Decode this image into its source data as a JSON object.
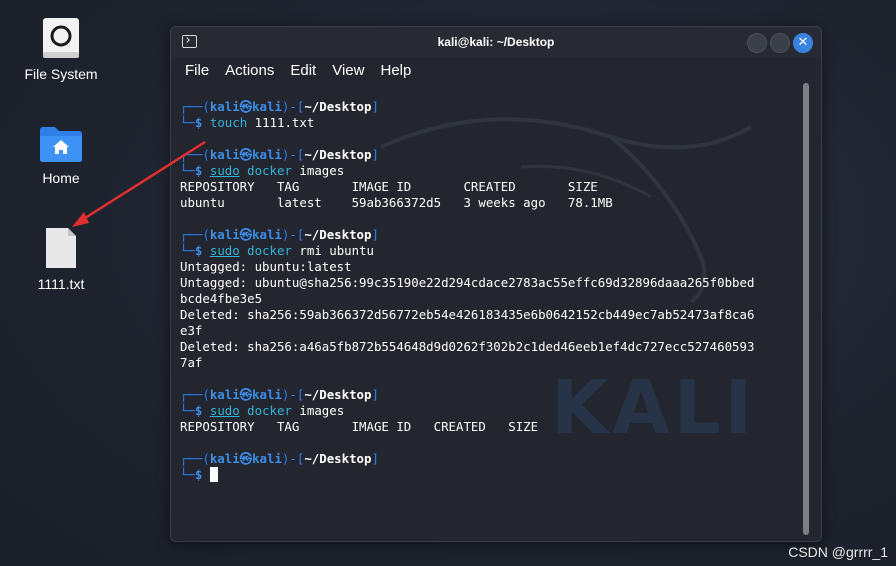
{
  "desktop": {
    "icons": [
      {
        "label": "File System",
        "icon": "drive-icon"
      },
      {
        "label": "Home",
        "icon": "home-folder-icon"
      },
      {
        "label": "1111.txt",
        "icon": "text-file-icon"
      }
    ]
  },
  "window": {
    "title": "kali@kali: ~/Desktop",
    "close_glyph": "✕",
    "menu": [
      "File",
      "Actions",
      "Edit",
      "View",
      "Help"
    ]
  },
  "prompt": {
    "frame_top": "┌──(",
    "user": "kali㉿kali",
    "frame_mid": ")-[",
    "path": "~/Desktop",
    "frame_end": "]",
    "frame_bottom": "└─",
    "dollar": "$"
  },
  "session": [
    {
      "cmd": "touch",
      "args": " 1111.txt",
      "sudo": false,
      "output": []
    },
    {
      "cmd": "docker",
      "args": " images",
      "sudo": true,
      "output": [
        "REPOSITORY   TAG       IMAGE ID       CREATED       SIZE",
        "ubuntu       latest    59ab366372d5   3 weeks ago   78.1MB"
      ]
    },
    {
      "cmd": "docker",
      "args": " rmi ubuntu",
      "sudo": true,
      "output": [
        "Untagged: ubuntu:latest",
        "Untagged: ubuntu@sha256:99c35190e22d294cdace2783ac55effc69d32896daaa265f0bbed",
        "bcde4fbe3e5",
        "Deleted: sha256:59ab366372d56772eb54e426183435e6b0642152cb449ec7ab52473af8ca6",
        "e3f",
        "Deleted: sha256:a46a5fb872b554648d9d0262f302b2c1ded46eeb1ef4dc727ecc527460593",
        "7af"
      ]
    },
    {
      "cmd": "docker",
      "args": " images",
      "sudo": true,
      "output": [
        "REPOSITORY   TAG       IMAGE ID   CREATED   SIZE"
      ]
    }
  ],
  "sudo_label": "sudo",
  "watermark": "KALI",
  "credit": "CSDN @grrrr_1",
  "colors": {
    "accent": "#3b8eea",
    "command": "#2fb4d8",
    "close_button": "#3a82e0",
    "arrow": "#e03030"
  }
}
